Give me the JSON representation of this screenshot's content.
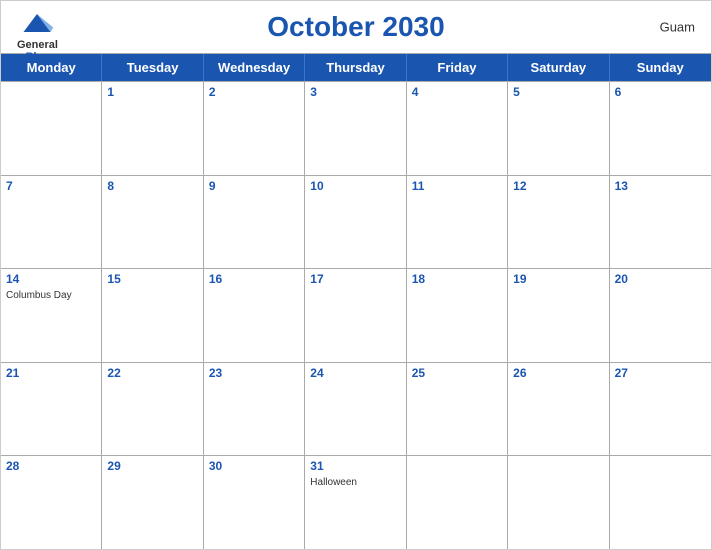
{
  "header": {
    "title": "October 2030",
    "region": "Guam",
    "logo_general": "General",
    "logo_blue": "Blue"
  },
  "days_of_week": [
    "Monday",
    "Tuesday",
    "Wednesday",
    "Thursday",
    "Friday",
    "Saturday",
    "Sunday"
  ],
  "weeks": [
    [
      {
        "number": "",
        "event": ""
      },
      {
        "number": "1",
        "event": ""
      },
      {
        "number": "2",
        "event": ""
      },
      {
        "number": "3",
        "event": ""
      },
      {
        "number": "4",
        "event": ""
      },
      {
        "number": "5",
        "event": ""
      },
      {
        "number": "6",
        "event": ""
      }
    ],
    [
      {
        "number": "7",
        "event": ""
      },
      {
        "number": "8",
        "event": ""
      },
      {
        "number": "9",
        "event": ""
      },
      {
        "number": "10",
        "event": ""
      },
      {
        "number": "11",
        "event": ""
      },
      {
        "number": "12",
        "event": ""
      },
      {
        "number": "13",
        "event": ""
      }
    ],
    [
      {
        "number": "14",
        "event": "Columbus Day"
      },
      {
        "number": "15",
        "event": ""
      },
      {
        "number": "16",
        "event": ""
      },
      {
        "number": "17",
        "event": ""
      },
      {
        "number": "18",
        "event": ""
      },
      {
        "number": "19",
        "event": ""
      },
      {
        "number": "20",
        "event": ""
      }
    ],
    [
      {
        "number": "21",
        "event": ""
      },
      {
        "number": "22",
        "event": ""
      },
      {
        "number": "23",
        "event": ""
      },
      {
        "number": "24",
        "event": ""
      },
      {
        "number": "25",
        "event": ""
      },
      {
        "number": "26",
        "event": ""
      },
      {
        "number": "27",
        "event": ""
      }
    ],
    [
      {
        "number": "28",
        "event": ""
      },
      {
        "number": "29",
        "event": ""
      },
      {
        "number": "30",
        "event": ""
      },
      {
        "number": "31",
        "event": "Halloween"
      },
      {
        "number": "",
        "event": ""
      },
      {
        "number": "",
        "event": ""
      },
      {
        "number": "",
        "event": ""
      }
    ]
  ],
  "colors": {
    "accent": "#1a56b0",
    "header_bg": "#1a56b0",
    "header_text": "#ffffff",
    "cell_bg": "#ffffff",
    "border": "#aaaaaa"
  }
}
